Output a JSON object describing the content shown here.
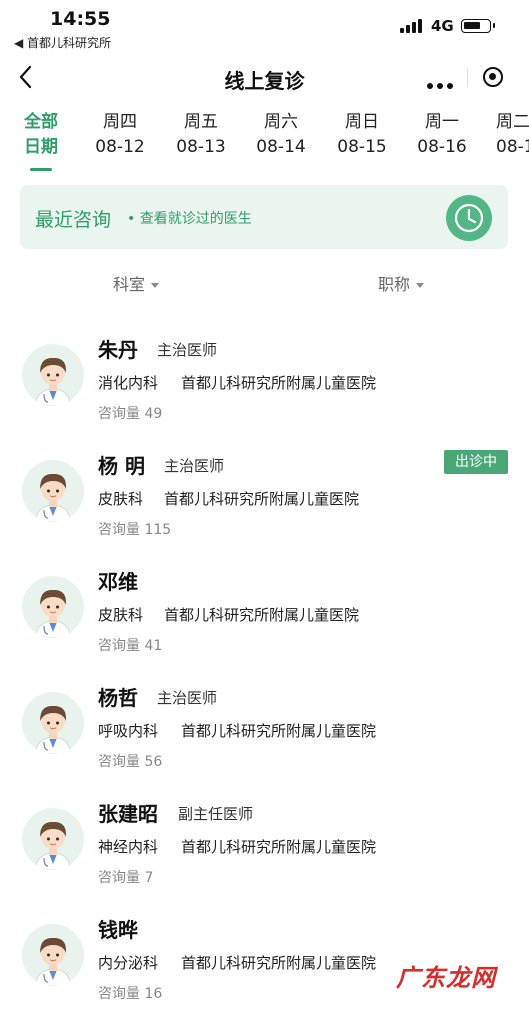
{
  "status_bar": {
    "time": "14:55",
    "back_app": "◀ 首都儿科研究所",
    "network": "4G"
  },
  "nav": {
    "title": "线上复诊"
  },
  "date_tabs": [
    {
      "top": "全部",
      "bottom": "日期"
    },
    {
      "top": "周四",
      "bottom": "08-12"
    },
    {
      "top": "周五",
      "bottom": "08-13"
    },
    {
      "top": "周六",
      "bottom": "08-14"
    },
    {
      "top": "周日",
      "bottom": "08-15"
    },
    {
      "top": "周一",
      "bottom": "08-16"
    },
    {
      "top": "周二",
      "bottom": "08-17"
    }
  ],
  "recent": {
    "title": "最近咨询",
    "subtitle": "• 查看就诊过的医生"
  },
  "filters": {
    "department": "科室",
    "title": "职称"
  },
  "doctors": [
    {
      "name": "朱丹",
      "title": "主治医师",
      "dept": "消化内科",
      "hospital": "首都儿科研究所附属儿童医院",
      "volume": "咨询量 49"
    },
    {
      "name": "杨 明",
      "title": "主治医师",
      "dept": "皮肤科",
      "hospital": "首都儿科研究所附属儿童医院",
      "volume": "咨询量 115",
      "badge": "出诊中"
    },
    {
      "name": "邓维",
      "title": "",
      "dept": "皮肤科",
      "hospital": "首都儿科研究所附属儿童医院",
      "volume": "咨询量 41"
    },
    {
      "name": "杨哲",
      "title": "主治医师",
      "dept": "呼吸内科",
      "hospital": "首都儿科研究所附属儿童医院",
      "volume": "咨询量 56"
    },
    {
      "name": "张建昭",
      "title": "副主任医师",
      "dept": "神经内科",
      "hospital": "首都儿科研究所附属儿童医院",
      "volume": "咨询量 7"
    },
    {
      "name": "钱晔",
      "title": "",
      "dept": "内分泌科",
      "hospital": "首都儿科研究所附属儿童医院",
      "volume": "咨询量 16"
    }
  ],
  "watermark": "广东龙网",
  "colors": {
    "accent": "#2f9e6b",
    "banner_bg": "#e9f5ee",
    "badge": "#4aa878"
  },
  "icons": [
    "back-arrow-icon",
    "more-dots-icon",
    "close-target-icon",
    "clock-icon",
    "caret-down-icon",
    "doctor-avatar-icon"
  ]
}
